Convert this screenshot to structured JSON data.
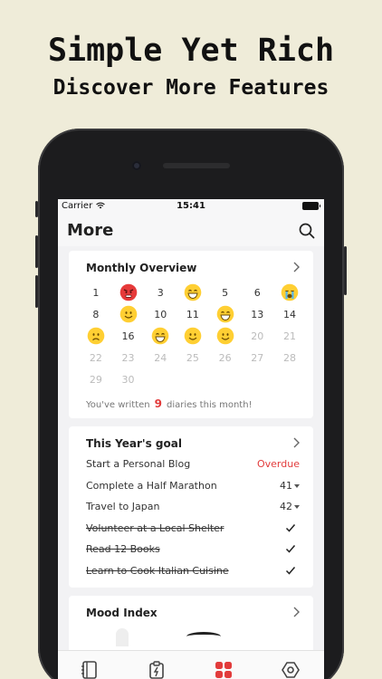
{
  "promo": {
    "title": "Simple Yet Rich",
    "subtitle": "Discover More Features"
  },
  "status_bar": {
    "carrier": "Carrier",
    "time": "15:41"
  },
  "header": {
    "title": "More",
    "search_icon": "search-icon"
  },
  "monthly": {
    "title": "Monthly Overview",
    "rows": [
      [
        {
          "d": "1"
        },
        {
          "e": "angry"
        },
        {
          "d": "3"
        },
        {
          "e": "laugh"
        },
        {
          "d": "5"
        },
        {
          "d": "6"
        },
        {
          "e": "cry"
        }
      ],
      [
        {
          "d": "8"
        },
        {
          "e": "smile"
        },
        {
          "d": "10"
        },
        {
          "d": "11"
        },
        {
          "e": "laugh"
        },
        {
          "d": "13"
        },
        {
          "d": "14"
        }
      ],
      [
        {
          "e": "sad"
        },
        {
          "d": "16"
        },
        {
          "e": "laugh"
        },
        {
          "e": "smile"
        },
        {
          "e": "smile"
        },
        {
          "d": "20",
          "dim": true
        },
        {
          "d": "21",
          "dim": true
        }
      ],
      [
        {
          "d": "22",
          "dim": true
        },
        {
          "d": "23",
          "dim": true
        },
        {
          "d": "24",
          "dim": true
        },
        {
          "d": "25",
          "dim": true
        },
        {
          "d": "26",
          "dim": true
        },
        {
          "d": "27",
          "dim": true
        },
        {
          "d": "28",
          "dim": true
        }
      ],
      [
        {
          "d": "29",
          "dim": true
        },
        {
          "d": "30",
          "dim": true
        }
      ]
    ],
    "written_prefix": "You've written",
    "written_count": "9",
    "written_suffix": "diaries this month!"
  },
  "goals": {
    "title": "This Year's goal",
    "items": [
      {
        "name": "Start a Personal Blog",
        "value": "Overdue",
        "done": false
      },
      {
        "name": "Complete a Half Marathon",
        "value": "41",
        "done": false
      },
      {
        "name": "Travel to Japan",
        "value": "42",
        "done": false
      },
      {
        "name": "Volunteer at a Local Shelter",
        "value": "",
        "done": true
      },
      {
        "name": "Read 12 Books",
        "value": "",
        "done": true
      },
      {
        "name": "Learn to Cook Italian Cuisine",
        "value": "",
        "done": true
      }
    ]
  },
  "mood": {
    "title": "Mood Index"
  },
  "tabs": [
    {
      "name": "diary-tab",
      "icon": "notebook-icon"
    },
    {
      "name": "todo-tab",
      "icon": "clipboard-icon"
    },
    {
      "name": "more-tab",
      "icon": "grid-icon",
      "active": true
    },
    {
      "name": "settings-tab",
      "icon": "hexagon-gear-icon"
    }
  ],
  "colors": {
    "accent": "#e23b3b",
    "background": "#efecd9"
  }
}
